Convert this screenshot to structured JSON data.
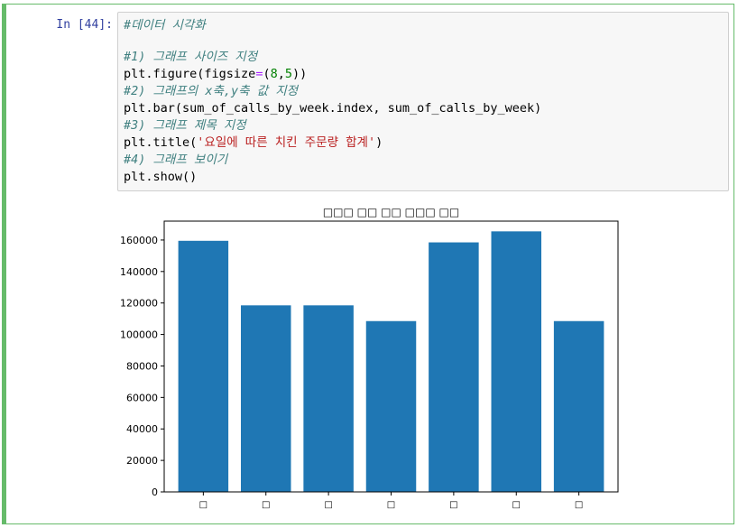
{
  "cell": {
    "prompt": "In [44]:",
    "accent_color": "#66bb6a",
    "code": {
      "line1_comment": "#데이터 시각화",
      "line2_comment": "#1) 그래프 사이즈 지정",
      "line3_pre": "plt.figure(figsize",
      "line3_eq": "=",
      "line3_open": "(",
      "line3_n1": "8",
      "line3_comma": ",",
      "line3_n2": "5",
      "line3_close": "))",
      "line4_comment": "#2) 그래프의 x축,y축 값 지정",
      "line5": "plt.bar(sum_of_calls_by_week.index, sum_of_calls_by_week)",
      "line6_comment": "#3) 그래프 제목 지정",
      "line7_pre": "plt.title(",
      "line7_str": "'요일에 따른 치킨 주문량 합계'",
      "line7_post": ")",
      "line8_comment": "#4) 그래프 보이기",
      "line9": "plt.show()"
    }
  },
  "chart_data": {
    "type": "bar",
    "title": "□□□ □□ □□ □□□ □□",
    "categories": [
      "□",
      "□",
      "□",
      "□",
      "□",
      "□",
      "□"
    ],
    "values": [
      159500,
      118500,
      118500,
      108500,
      158500,
      165500,
      108500
    ],
    "ylim": [
      0,
      172000
    ],
    "yticks": [
      0,
      20000,
      40000,
      60000,
      80000,
      100000,
      120000,
      140000,
      160000
    ],
    "ytick_labels": [
      "0",
      "20000",
      "40000",
      "60000",
      "80000",
      "100000",
      "120000",
      "140000",
      "160000"
    ],
    "bar_color": "#1f77b4",
    "grid": false,
    "xlabel": "",
    "ylabel": ""
  }
}
